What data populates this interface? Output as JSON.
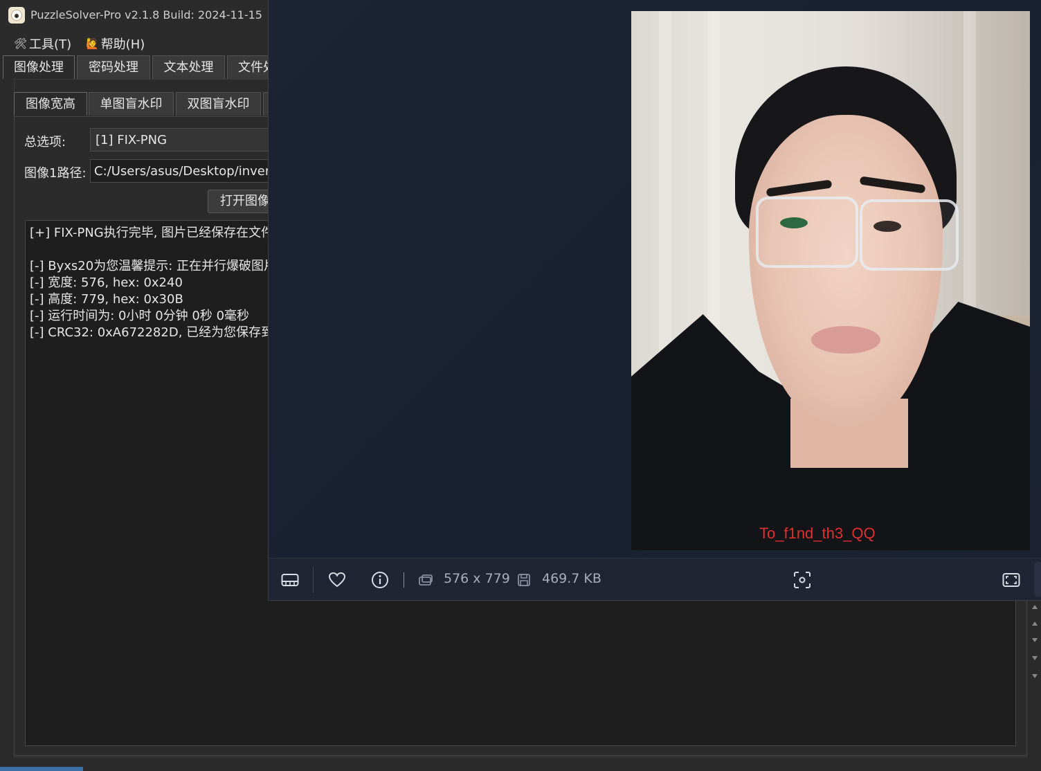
{
  "app": {
    "title": "PuzzleSolver-Pro v2.1.8  Build: 2024-11-15"
  },
  "menu": {
    "items": [
      {
        "label": "工具(T)",
        "icon": "tools-icon"
      },
      {
        "label": "帮助(H)",
        "icon": "help-person-icon"
      }
    ]
  },
  "main_tabs": [
    {
      "label": "图像处理",
      "active": true
    },
    {
      "label": "密码处理",
      "active": false
    },
    {
      "label": "文本处理",
      "active": false
    },
    {
      "label": "文件处",
      "active": false
    }
  ],
  "sub_tabs": [
    {
      "label": "图像宽高",
      "active": true
    },
    {
      "label": "单图盲水印",
      "active": false
    },
    {
      "label": "双图盲水印",
      "active": false
    }
  ],
  "form": {
    "option_label": "总选项:",
    "option_value": "[1] FIX-PNG",
    "path_label": "图像1路径:",
    "path_value": "C:/Users/asus/Desktop/invers",
    "open_button": "打开图像"
  },
  "log": [
    "[+] FIX-PNG执行完毕, 图片已经保存在文件",
    "",
    "[-] Byxs20为您温馨提示: 正在并行爆破图片",
    "[-] 宽度: 576, hex: 0x240",
    "[-] 高度: 779, hex: 0x30B",
    "[-] 运行时间为:  0小时 0分钟 0秒 0毫秒",
    "[-] CRC32: 0xA672282D, 已经为您保存到运"
  ],
  "viewer": {
    "image_watermark": "To_f1nd_th3_QQ",
    "dimensions": "576 x 779",
    "file_size": "469.7 KB",
    "icons": [
      "filmstrip-icon",
      "heart-icon",
      "info-icon",
      "dimensions-icon",
      "save-icon",
      "focus-icon",
      "fullscreen-icon"
    ]
  },
  "colors": {
    "app_bg": "#2b2b2b",
    "viewer_bg": "#1c2433",
    "watermark_red": "#e03030"
  }
}
